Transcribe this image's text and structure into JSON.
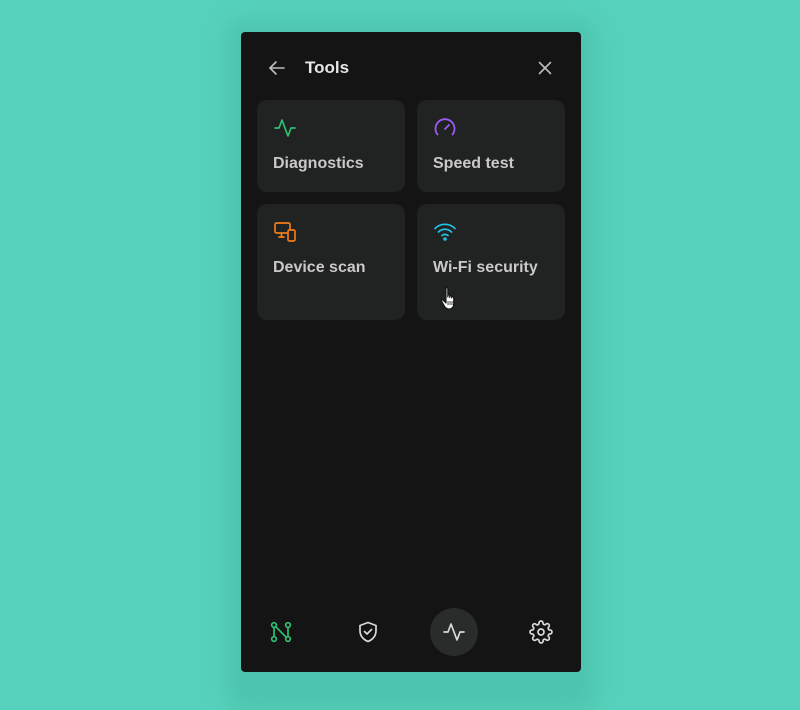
{
  "header": {
    "title": "Tools",
    "back_icon": "arrow-left-icon",
    "close_icon": "close-icon"
  },
  "tools": [
    {
      "label": "Diagnostics",
      "icon": "activity-icon",
      "color": "#2fbf71"
    },
    {
      "label": "Speed test",
      "icon": "speedometer-icon",
      "color": "#9b59f5"
    },
    {
      "label": "Device scan",
      "icon": "devices-icon",
      "color": "#f07c1a"
    },
    {
      "label": "Wi-Fi security",
      "icon": "wifi-icon",
      "color": "#22c3e6"
    }
  ],
  "bottom_nav": [
    {
      "icon": "network-nodes-icon",
      "color": "#2fbf71",
      "active": false
    },
    {
      "icon": "shield-check-icon",
      "color": "#d9d9d9",
      "active": false
    },
    {
      "icon": "activity-icon",
      "color": "#d9d9d9",
      "active": true
    },
    {
      "icon": "gear-icon",
      "color": "#d9d9d9",
      "active": false
    }
  ],
  "colors": {
    "background": "#56d1bb",
    "panel": "#141414",
    "card": "#212222"
  }
}
